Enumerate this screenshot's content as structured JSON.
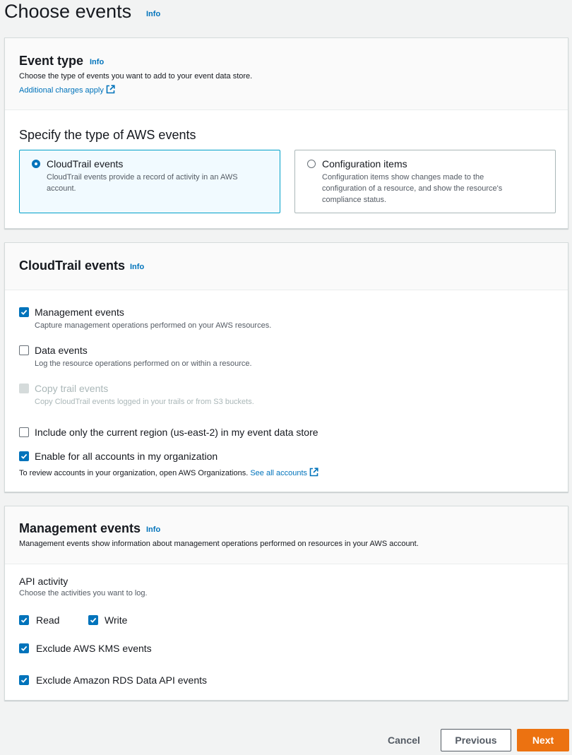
{
  "page": {
    "title": "Choose events",
    "info": "Info"
  },
  "event_type": {
    "title": "Event type",
    "info": "Info",
    "description": "Choose the type of events you want to add to your event data store.",
    "charges_link": "Additional charges apply",
    "subheading": "Specify the type of AWS events",
    "options": [
      {
        "title": "CloudTrail events",
        "desc_line1": "CloudTrail events provide a record of activity in an AWS",
        "desc_line2": "account.",
        "selected": true
      },
      {
        "title": "Configuration items",
        "desc_line1": "Configuration items show changes made to the",
        "desc_line2": "configuration of a resource, and show the resource's",
        "desc_line3": "compliance status.",
        "selected": false
      }
    ]
  },
  "cloudtrail": {
    "title": "CloudTrail events",
    "info": "Info",
    "items": [
      {
        "label": "Management events",
        "desc": "Capture management operations performed on your AWS resources.",
        "checked": true
      },
      {
        "label": "Data events",
        "desc": "Log the resource operations performed on or within a resource.",
        "checked": false
      },
      {
        "label": "Copy trail events",
        "desc": "Copy CloudTrail events logged in your trails or from S3 buckets.",
        "checked": false,
        "disabled": true
      },
      {
        "label": "Include only the current region (us-east-2) in my event data store",
        "checked": false
      },
      {
        "label": "Enable for all accounts in my organization",
        "checked": true
      }
    ],
    "org_note": "To review accounts in your organization, open AWS Organizations.",
    "see_all_link": "See all accounts"
  },
  "management": {
    "title": "Management events",
    "info": "Info",
    "description": "Management events show information about management operations performed on resources in your AWS account.",
    "api_label": "API activity",
    "api_desc": "Choose the activities you want to log.",
    "read": "Read",
    "write": "Write",
    "exclude_kms": "Exclude AWS KMS events",
    "exclude_rds": "Exclude Amazon RDS Data API events"
  },
  "footer": {
    "cancel": "Cancel",
    "previous": "Previous",
    "next": "Next"
  },
  "colors": {
    "primary": "#ec7211",
    "link": "#0073bb",
    "selected_border": "#00a1c9"
  }
}
